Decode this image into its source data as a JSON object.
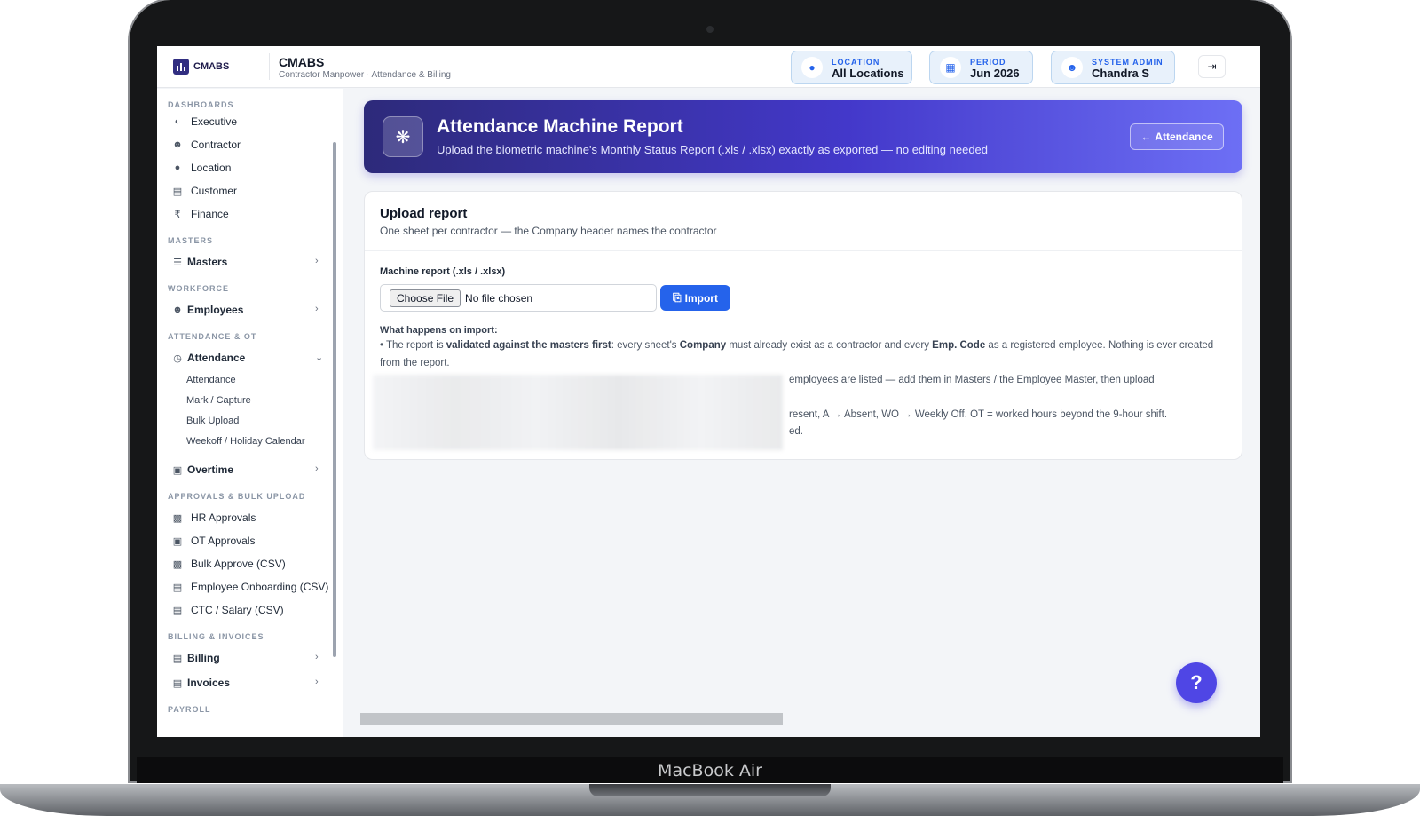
{
  "device": {
    "brand": "MacBook Air"
  },
  "topbar": {
    "logo_text": "CMABS",
    "title": "CMABS",
    "subtitle": "Contractor Manpower · Attendance & Billing",
    "location": {
      "caption": "LOCATION",
      "value": "All Locations"
    },
    "period": {
      "caption": "PERIOD",
      "value": "Jun 2026"
    },
    "user": {
      "caption": "SYSTEM ADMIN",
      "value": "Chandra S"
    }
  },
  "sidebar": {
    "dashboards_title": "DASHBOARDS",
    "dashboards": [
      "Executive",
      "Contractor",
      "Location",
      "Customer",
      "Finance"
    ],
    "masters_title": "MASTERS",
    "masters_group": "Masters",
    "workforce_title": "WORKFORCE",
    "employees_group": "Employees",
    "attendance_title": "ATTENDANCE & OT",
    "attendance_group": "Attendance",
    "attendance_items": [
      "Attendance",
      "Mark / Capture",
      "Bulk Upload",
      "Weekoff / Holiday Calendar"
    ],
    "overtime_group": "Overtime",
    "approvals_title": "APPROVALS & BULK UPLOAD",
    "approvals": [
      "HR Approvals",
      "OT Approvals",
      "Bulk Approve (CSV)",
      "Employee Onboarding (CSV)",
      "CTC / Salary (CSV)"
    ],
    "billing_title": "BILLING & INVOICES",
    "billing_group": "Billing",
    "invoices_group": "Invoices",
    "payroll_title": "PAYROLL"
  },
  "hero": {
    "title": "Attendance Machine Report",
    "subtitle": "Upload the biometric machine's Monthly Status Report (.xls / .xlsx) exactly as exported — no editing needed",
    "back_button": "Attendance"
  },
  "upload": {
    "title": "Upload report",
    "subtitle": "One sheet per contractor — the Company header names the contractor",
    "field_label": "Machine report (.xls / .xlsx)",
    "choose_label": "Choose File",
    "file_status": "No file chosen",
    "import_label": "Import",
    "what_happens": "What happens on import:",
    "p1_a": "• The report is ",
    "p1_b": "validated against the masters first",
    "p1_c": ": every sheet's ",
    "p1_d": "Company",
    "p1_e": " must already exist as a contractor and every ",
    "p1_f": "Emp. Code",
    "p1_g": " as a registered employee. Nothing is ever created from the report.",
    "p2": "employees are listed — add them in Masters / the Employee Master, then upload",
    "p3": "resent, A → Absent, WO → Weekly Off. OT = worked hours beyond the 9-hour shift.",
    "p4": "ed."
  },
  "help_label": "?",
  "colors": {
    "accent": "#2563eb",
    "hero_start": "#2d2a7a",
    "hero_end": "#6d6ff5",
    "help": "#4f46e5"
  }
}
